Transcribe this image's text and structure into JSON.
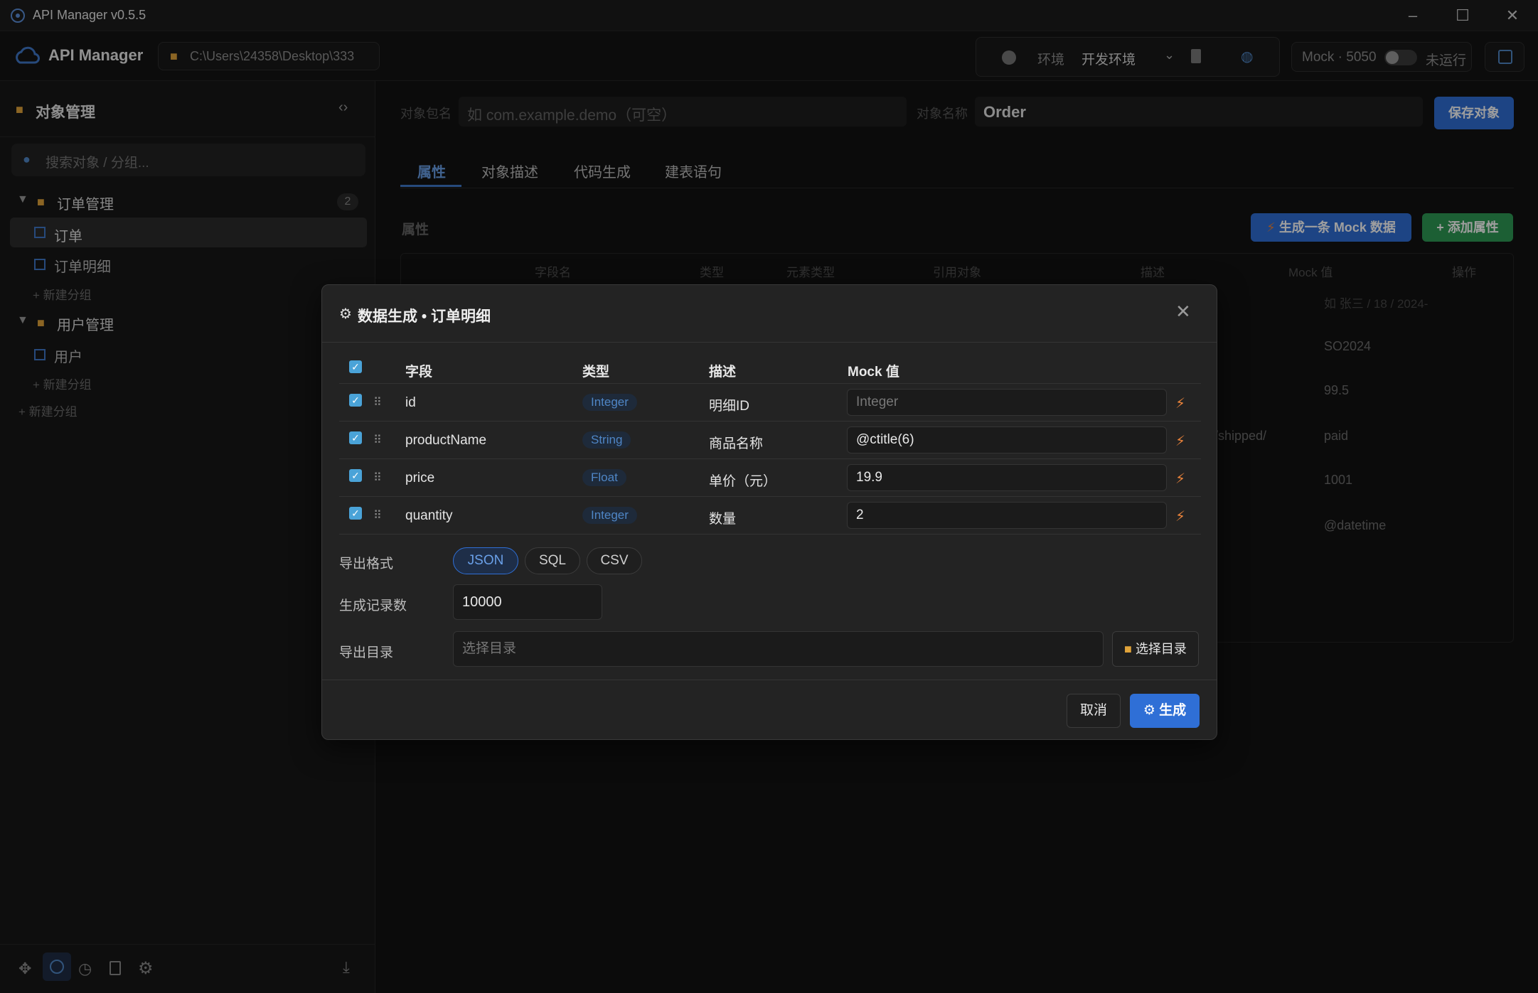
{
  "window": {
    "title": "API Manager v0.5.5"
  },
  "topbar": {
    "app_name": "API Manager",
    "path": "C:\\Users\\24358\\Desktop\\333",
    "env_label": "环境",
    "env_value": "开发环境",
    "mock_label": "Mock · 5050",
    "mock_status": "未运行"
  },
  "sidebar": {
    "title": "对象管理",
    "search_placeholder": "搜索对象 / 分组...",
    "groups": [
      {
        "name": "订单管理",
        "count": "2",
        "items": [
          "订单",
          "订单明细"
        ],
        "add": "+ 新建分组"
      },
      {
        "name": "用户管理",
        "items": [
          "用户"
        ],
        "add": "+ 新建分组"
      }
    ],
    "root_add": "+ 新建分组"
  },
  "main": {
    "package_label": "对象包名",
    "package_placeholder": "如 com.example.demo（可空）",
    "name_label": "对象名称",
    "name_value": "Order",
    "save_button": "保存对象",
    "tabs": [
      "属性",
      "对象描述",
      "代码生成",
      "建表语句"
    ],
    "section_title": "属性",
    "mock_one_button": "生成一条 Mock 数据",
    "add_attr_button": "+ 添加属性",
    "table_headers": [
      "字段名",
      "类型",
      "元素类型",
      "引用对象",
      "描述",
      "Mock 值",
      "操作"
    ],
    "mock_values": [
      "如 张三 / 18 / 2024-",
      "SO2024",
      "99.5",
      "paid",
      "1001",
      "@datetime"
    ],
    "partial_desc": "/shipped/"
  },
  "modal": {
    "title": "数据生成 • 订单明细",
    "headers": {
      "field": "字段",
      "type": "类型",
      "desc": "描述",
      "mock": "Mock 值"
    },
    "rows": [
      {
        "field": "id",
        "type": "Integer",
        "desc": "明细ID",
        "mock": "",
        "mock_placeholder": "Integer"
      },
      {
        "field": "productName",
        "type": "String",
        "desc": "商品名称",
        "mock": "@ctitle(6)"
      },
      {
        "field": "price",
        "type": "Float",
        "desc": "单价（元）",
        "mock": "19.9"
      },
      {
        "field": "quantity",
        "type": "Integer",
        "desc": "数量",
        "mock": "2"
      }
    ],
    "export_format_label": "导出格式",
    "formats": [
      "JSON",
      "SQL",
      "CSV"
    ],
    "selected_format": "JSON",
    "count_label": "生成记录数",
    "count_value": "10000",
    "dir_label": "导出目录",
    "dir_placeholder": "选择目录",
    "dir_button": "选择目录",
    "cancel_button": "取消",
    "generate_button": "生成"
  },
  "colors": {
    "accent": "#2f6fd6",
    "checkbox": "#4aa3d8",
    "bolt": "#e8823a",
    "green": "#2e9a54"
  }
}
